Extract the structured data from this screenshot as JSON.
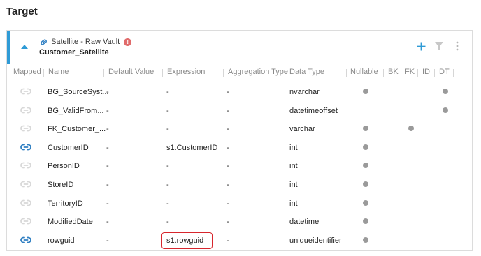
{
  "page": {
    "title": "Target"
  },
  "panel": {
    "type_label": "Satellite - Raw Vault",
    "name": "Customer_Satellite",
    "warning_glyph": "!",
    "colors": {
      "accent": "#2f9bd6",
      "warning": "#e06b6b",
      "highlight": "#d7262d",
      "link_active": "#2f7fc2"
    },
    "icons": {
      "collapse": "chevron-up-icon",
      "type": "link-icon",
      "add": "plus-icon",
      "filter": "filter-icon",
      "more": "more-vertical-icon"
    }
  },
  "columns": {
    "mapped": "Mapped",
    "name": "Name",
    "default_value": "Default Value",
    "expression": "Expression",
    "aggregation_type": "Aggregation Type",
    "data_type": "Data Type",
    "nullable": "Nullable",
    "bk": "BK",
    "fk": "FK",
    "id": "ID",
    "dt": "DT"
  },
  "rows": [
    {
      "mapped": false,
      "name": "BG_SourceSyst...",
      "default_value": "-",
      "expression": "-",
      "aggregation": "-",
      "data_type": "nvarchar",
      "nullable": true,
      "bk": false,
      "fk": false,
      "id": false,
      "dt": true
    },
    {
      "mapped": false,
      "name": "BG_ValidFrom...",
      "default_value": "-",
      "expression": "-",
      "aggregation": "-",
      "data_type": "datetimeoffset",
      "nullable": false,
      "bk": false,
      "fk": false,
      "id": false,
      "dt": true
    },
    {
      "mapped": false,
      "name": "FK_Customer_...",
      "default_value": "-",
      "expression": "-",
      "aggregation": "-",
      "data_type": "varchar",
      "nullable": true,
      "bk": false,
      "fk": true,
      "id": false,
      "dt": false
    },
    {
      "mapped": true,
      "name": "CustomerID",
      "default_value": "-",
      "expression": "s1.CustomerID",
      "aggregation": "-",
      "data_type": "int",
      "nullable": true,
      "bk": false,
      "fk": false,
      "id": false,
      "dt": false
    },
    {
      "mapped": false,
      "name": "PersonID",
      "default_value": "-",
      "expression": "-",
      "aggregation": "-",
      "data_type": "int",
      "nullable": true,
      "bk": false,
      "fk": false,
      "id": false,
      "dt": false
    },
    {
      "mapped": false,
      "name": "StoreID",
      "default_value": "-",
      "expression": "-",
      "aggregation": "-",
      "data_type": "int",
      "nullable": true,
      "bk": false,
      "fk": false,
      "id": false,
      "dt": false
    },
    {
      "mapped": false,
      "name": "TerritoryID",
      "default_value": "-",
      "expression": "-",
      "aggregation": "-",
      "data_type": "int",
      "nullable": true,
      "bk": false,
      "fk": false,
      "id": false,
      "dt": false
    },
    {
      "mapped": false,
      "name": "ModifiedDate",
      "default_value": "-",
      "expression": "-",
      "aggregation": "-",
      "data_type": "datetime",
      "nullable": true,
      "bk": false,
      "fk": false,
      "id": false,
      "dt": false
    },
    {
      "mapped": true,
      "name": "rowguid",
      "default_value": "-",
      "expression": "s1.rowguid",
      "aggregation": "-",
      "data_type": "uniqueidentifier",
      "nullable": true,
      "bk": false,
      "fk": false,
      "id": false,
      "dt": false,
      "highlighted": true
    }
  ]
}
